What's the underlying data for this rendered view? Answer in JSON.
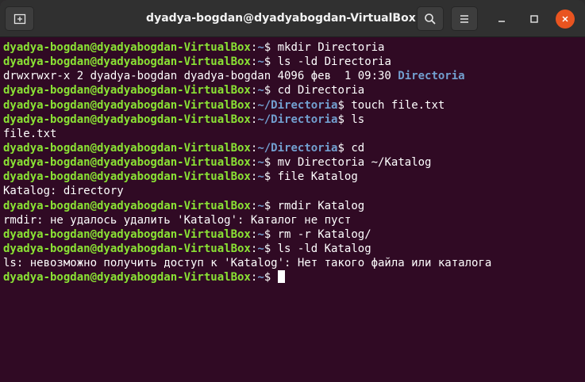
{
  "window": {
    "title": "dyadya-bogdan@dyadyabogdan-VirtualBox: ~",
    "icons": {
      "new_tab": "new-tab-icon",
      "search": "search-icon",
      "menu": "hamburger-menu-icon",
      "minimize": "minimize-icon",
      "maximize": "maximize-icon",
      "close": "close-icon"
    }
  },
  "colors": {
    "background": "#300a24",
    "prompt_user": "#8ae234",
    "prompt_path": "#729fcf",
    "text": "#ffffff",
    "close_button": "#e95420"
  },
  "terminal": {
    "prompt_user": "dyadya-bogdan@dyadyabogdan-VirtualBox",
    "lines": [
      {
        "type": "prompt",
        "path": "~",
        "cmd": " mkdir Directoria"
      },
      {
        "type": "prompt",
        "path": "~",
        "cmd": " ls -ld Directoria"
      },
      {
        "type": "output",
        "text": "drwxrwxr-x 2 dyadya-bogdan dyadya-bogdan 4096 фев  1 09:30 ",
        "dir": "Directoria"
      },
      {
        "type": "prompt",
        "path": "~",
        "cmd": " cd Directoria"
      },
      {
        "type": "prompt",
        "path": "~/Directoria",
        "cmd": " touch file.txt"
      },
      {
        "type": "prompt",
        "path": "~/Directoria",
        "cmd": " ls"
      },
      {
        "type": "output",
        "text": "file.txt"
      },
      {
        "type": "prompt",
        "path": "~/Directoria",
        "cmd": " cd"
      },
      {
        "type": "prompt",
        "path": "~",
        "cmd": " mv Directoria ~/Katalog"
      },
      {
        "type": "prompt",
        "path": "~",
        "cmd": " file Katalog"
      },
      {
        "type": "output",
        "text": "Katalog: directory"
      },
      {
        "type": "prompt",
        "path": "~",
        "cmd": " rmdir Katalog"
      },
      {
        "type": "output",
        "text": "rmdir: не удалось удалить 'Katalog': Каталог не пуст"
      },
      {
        "type": "prompt",
        "path": "~",
        "cmd": " rm -r Katalog/"
      },
      {
        "type": "prompt",
        "path": "~",
        "cmd": " ls -ld Katalog"
      },
      {
        "type": "output",
        "text": "ls: невозможно получить доступ к 'Katalog': Нет такого файла или каталога"
      },
      {
        "type": "prompt",
        "path": "~",
        "cmd": "",
        "cursor": true
      }
    ]
  }
}
